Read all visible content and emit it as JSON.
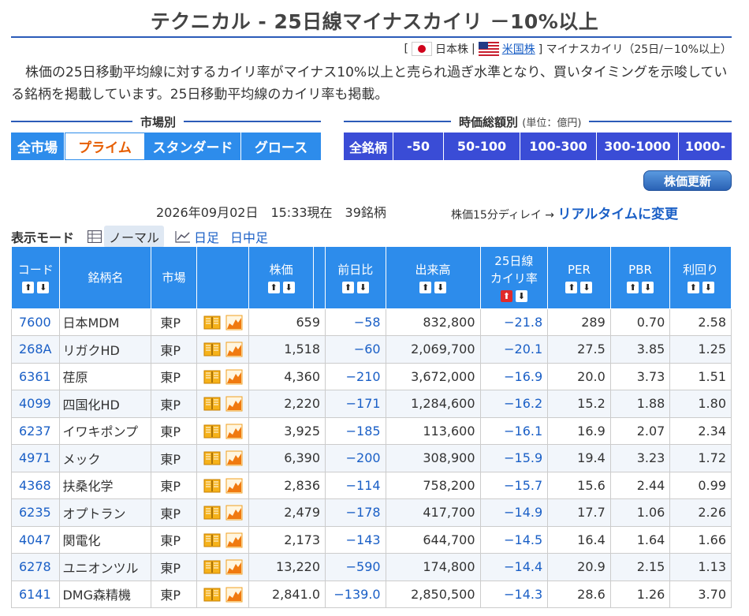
{
  "title": "テクニカル - 25日線マイナスカイリ －10%以上",
  "market_links": {
    "open_bracket": "[",
    "jp": "日本株",
    "sep": "|",
    "us": "米国株",
    "close": "] マイナスカイリ（25日/－10%以上）"
  },
  "description": "株価の25日移動平均線に対するカイリ率がマイナス10%以上と売られ過ぎ水準となり、買いタイミングを示唆している銘柄を掲載しています。25日移動平均線のカイリ率も掲載。",
  "market_section": {
    "label": "市場別",
    "buttons": [
      "全市場",
      "プライム",
      "スタンダード",
      "グロース"
    ],
    "active": "プライム"
  },
  "cap_section": {
    "label": "時価総額別",
    "unit": "(単位：億円)",
    "buttons": [
      "全銘柄",
      "-50",
      "50-100",
      "100-300",
      "300-1000",
      "1000-"
    ]
  },
  "update_button": "株価更新",
  "status": "2026年09月02日　15:33現在　39銘柄",
  "delay_text": "株価15分ディレイ → ",
  "realtime_link": "リアルタイムに変更",
  "mode": {
    "label": "表示モード",
    "normal": "ノーマル",
    "daily": "日足",
    "intraday": "日中足"
  },
  "columns": {
    "code": "コード",
    "name": "銘柄名",
    "market": "市場",
    "price": "株価",
    "change": "前日比",
    "volume": "出来高",
    "kairi1": "25日線",
    "kairi2": "カイリ率",
    "per": "PER",
    "pbr": "PBR",
    "yield": "利回り"
  },
  "rows": [
    {
      "code": "7600",
      "name": "日本MDM",
      "market": "東P",
      "price": "659",
      "change": "−58",
      "volume": "832,800",
      "kairi": "−21.8",
      "per": "289",
      "pbr": "0.70",
      "yield": "2.58"
    },
    {
      "code": "268A",
      "name": "リガクHD",
      "market": "東P",
      "price": "1,518",
      "change": "−60",
      "volume": "2,069,700",
      "kairi": "−20.1",
      "per": "27.5",
      "pbr": "3.85",
      "yield": "1.25"
    },
    {
      "code": "6361",
      "name": "荏原",
      "market": "東P",
      "price": "4,360",
      "change": "−210",
      "volume": "3,672,000",
      "kairi": "−16.9",
      "per": "20.0",
      "pbr": "3.73",
      "yield": "1.51"
    },
    {
      "code": "4099",
      "name": "四国化HD",
      "market": "東P",
      "price": "2,220",
      "change": "−171",
      "volume": "1,284,600",
      "kairi": "−16.2",
      "per": "15.2",
      "pbr": "1.88",
      "yield": "1.80"
    },
    {
      "code": "6237",
      "name": "イワキポンプ",
      "market": "東P",
      "price": "3,925",
      "change": "−185",
      "volume": "113,600",
      "kairi": "−16.1",
      "per": "16.9",
      "pbr": "2.07",
      "yield": "2.34"
    },
    {
      "code": "4971",
      "name": "メック",
      "market": "東P",
      "price": "6,390",
      "change": "−200",
      "volume": "308,900",
      "kairi": "−15.9",
      "per": "19.4",
      "pbr": "3.23",
      "yield": "1.72"
    },
    {
      "code": "4368",
      "name": "扶桑化学",
      "market": "東P",
      "price": "2,836",
      "change": "−114",
      "volume": "758,200",
      "kairi": "−15.7",
      "per": "15.6",
      "pbr": "2.44",
      "yield": "0.99"
    },
    {
      "code": "6235",
      "name": "オプトラン",
      "market": "東P",
      "price": "2,479",
      "change": "−178",
      "volume": "417,700",
      "kairi": "−14.9",
      "per": "17.7",
      "pbr": "1.06",
      "yield": "2.26"
    },
    {
      "code": "4047",
      "name": "関電化",
      "market": "東P",
      "price": "2,173",
      "change": "−143",
      "volume": "644,700",
      "kairi": "−14.5",
      "per": "16.4",
      "pbr": "1.64",
      "yield": "1.66"
    },
    {
      "code": "6278",
      "name": "ユニオンツル",
      "market": "東P",
      "price": "13,220",
      "change": "−590",
      "volume": "174,800",
      "kairi": "−14.4",
      "per": "20.9",
      "pbr": "2.15",
      "yield": "1.13"
    },
    {
      "code": "6141",
      "name": "DMG森精機",
      "market": "東P",
      "price": "2,841.0",
      "change": "−139.0",
      "volume": "2,850,500",
      "kairi": "−14.3",
      "per": "28.6",
      "pbr": "1.26",
      "yield": "3.70"
    }
  ],
  "sort_up": "⬆",
  "sort_down": "⬇"
}
